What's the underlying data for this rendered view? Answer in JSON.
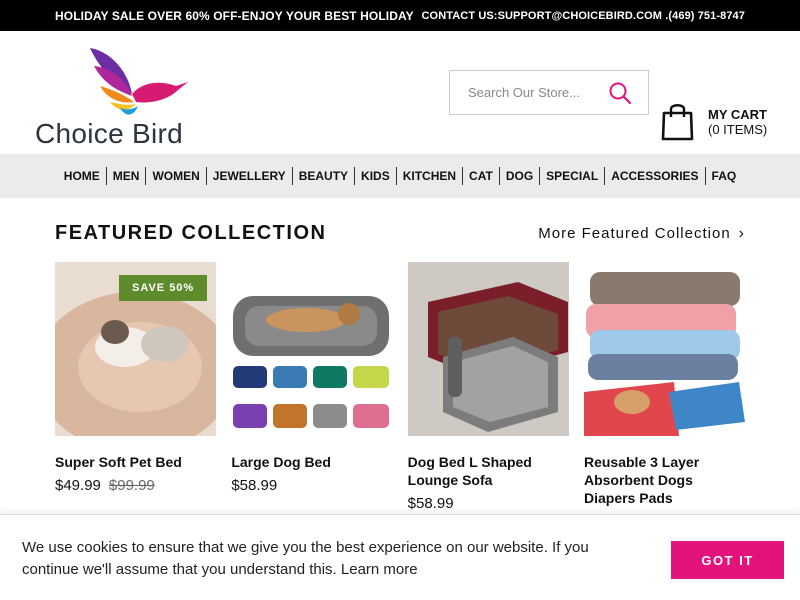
{
  "topbar": {
    "promo": "HOLIDAY SALE OVER 60% OFF-ENJOY YOUR BEST HOLIDAY",
    "contact": "CONTACT US:SUPPORT@CHOICEBIRD.COM .(469) 751-8747"
  },
  "brand": {
    "name": "Choice Bird"
  },
  "search": {
    "placeholder": "Search Our Store..."
  },
  "cart": {
    "title": "MY CART",
    "count": "(0 ITEMS)"
  },
  "nav": {
    "items": [
      {
        "label": "HOME"
      },
      {
        "label": "MEN"
      },
      {
        "label": "WOMEN"
      },
      {
        "label": "JEWELLERY"
      },
      {
        "label": "BEAUTY"
      },
      {
        "label": "KIDS"
      },
      {
        "label": "KITCHEN"
      },
      {
        "label": "CAT"
      },
      {
        "label": "DOG"
      },
      {
        "label": "SPECIAL"
      },
      {
        "label": "ACCESSORIES"
      },
      {
        "label": "FAQ"
      }
    ]
  },
  "featured": {
    "title": "FEATURED COLLECTION",
    "more": "More Featured Collection",
    "products": [
      {
        "name": "Super Soft Pet Bed",
        "price": "$49.99",
        "old_price": "$99.99",
        "badge": "SAVE 50%"
      },
      {
        "name": "Large Dog Bed",
        "price": "$58.99"
      },
      {
        "name": "Dog Bed L Shaped Lounge Sofa",
        "price": "$58.99"
      },
      {
        "name": "Reusable 3 Layer Absorbent Dogs Diapers Pads",
        "price": ""
      }
    ]
  },
  "cookie": {
    "text": "We use cookies to ensure that we give you the best experience on our website. If you continue we'll assume that you understand this. ",
    "learn_more": "Learn more",
    "button": "GOT IT"
  },
  "colors": {
    "accent": "#e2137d",
    "badge": "#5e8b2b",
    "nav_bg": "#ebebeb",
    "topbar_bg": "#000000"
  }
}
